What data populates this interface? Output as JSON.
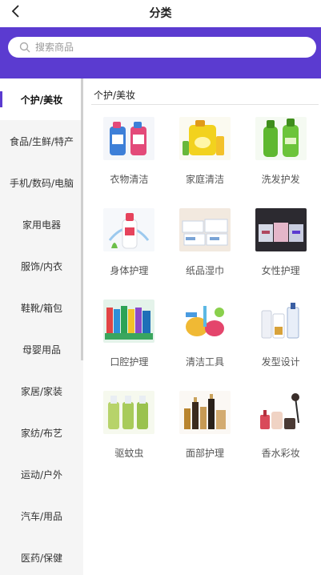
{
  "header": {
    "title": "分类"
  },
  "search": {
    "placeholder": "搜索商品"
  },
  "sidebar": {
    "items": [
      {
        "label": "个护/美妆",
        "active": true
      },
      {
        "label": "食品/生鲜/特产"
      },
      {
        "label": "手机/数码/电脑"
      },
      {
        "label": "家用电器"
      },
      {
        "label": "服饰/内衣"
      },
      {
        "label": "鞋靴/箱包"
      },
      {
        "label": "母婴用品"
      },
      {
        "label": "家居/家装"
      },
      {
        "label": "家纺/布艺"
      },
      {
        "label": "运动/户外"
      },
      {
        "label": "汽车/用品"
      },
      {
        "label": "医药/保健"
      }
    ]
  },
  "content": {
    "section_title": "个护/美妆",
    "items": [
      {
        "label": "衣物清洁",
        "icon": "laundry-detergent-image"
      },
      {
        "label": "家庭清洁",
        "icon": "household-cleaner-image"
      },
      {
        "label": "洗发护发",
        "icon": "shampoo-image"
      },
      {
        "label": "身体护理",
        "icon": "body-wash-image"
      },
      {
        "label": "纸品湿巾",
        "icon": "tissue-image"
      },
      {
        "label": "女性护理",
        "icon": "feminine-care-image"
      },
      {
        "label": "口腔护理",
        "icon": "oral-care-image"
      },
      {
        "label": "清洁工具",
        "icon": "cleaning-tools-image"
      },
      {
        "label": "发型设计",
        "icon": "hair-styling-image"
      },
      {
        "label": "驱蚊虫",
        "icon": "insect-repellent-image"
      },
      {
        "label": "面部护理",
        "icon": "facial-care-image"
      },
      {
        "label": "香水彩妆",
        "icon": "perfume-makeup-image"
      }
    ]
  },
  "colors": {
    "accent": "#5b3bd0",
    "sidebar_bg": "#f5f5f5"
  }
}
